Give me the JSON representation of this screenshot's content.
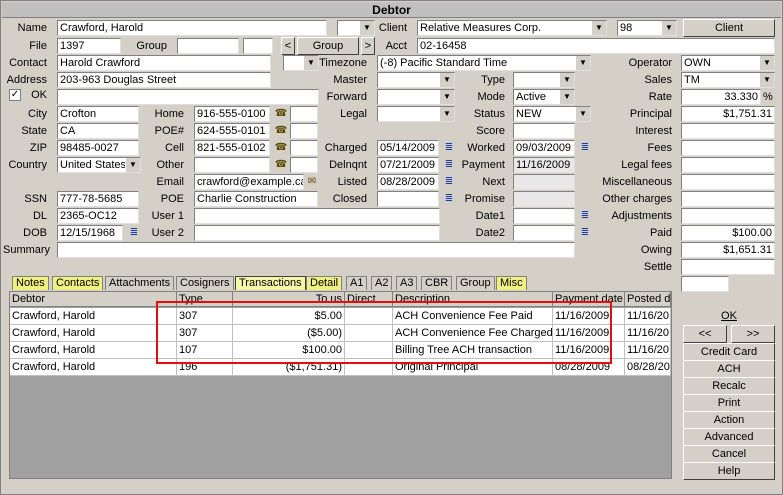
{
  "title": "Debtor",
  "labels": {
    "name": "Name",
    "file": "File",
    "group": "Group",
    "contact": "Contact",
    "address": "Address",
    "ok": "OK",
    "city": "City",
    "state": "State",
    "zip": "ZIP",
    "country": "Country",
    "ssn": "SSN",
    "dl": "DL",
    "dob": "DOB",
    "summary": "Summary",
    "home": "Home",
    "poe_num": "POE#",
    "cell": "Cell",
    "other": "Other",
    "email": "Email",
    "poe": "POE",
    "user1": "User 1",
    "user2": "User 2",
    "client": "Client",
    "acct": "Acct",
    "timezone": "Timezone",
    "master": "Master",
    "forward": "Forward",
    "legal": "Legal",
    "charged": "Charged",
    "delnqnt": "Delnqnt",
    "listed": "Listed",
    "closed": "Closed",
    "type": "Type",
    "mode": "Mode",
    "status": "Status",
    "score": "Score",
    "worked": "Worked",
    "payment": "Payment",
    "next": "Next",
    "promise": "Promise",
    "date1": "Date1",
    "date2": "Date2",
    "operator": "Operator",
    "sales": "Sales",
    "rate": "Rate",
    "principal": "Principal",
    "interest": "Interest",
    "fees": "Fees",
    "legal_fees": "Legal fees",
    "miscellaneous": "Miscellaneous",
    "other_charges": "Other charges",
    "adjustments": "Adjustments",
    "paid": "Paid",
    "owing": "Owing",
    "settle": "Settle"
  },
  "values": {
    "name": "Crawford, Harold",
    "file": "1397",
    "contact": "Harold Crawford",
    "address": "203-963 Douglas Street",
    "city": "Crofton",
    "state": "CA",
    "zip": "98485-0027",
    "country": "United States",
    "ssn": "777-78-5685",
    "dl": "2365-OC12",
    "dob": "12/15/1968",
    "home": "916-555-0100",
    "poe_num": "624-555-0101",
    "cell": "821-555-0102",
    "email": "crawford@example.ca",
    "poe": "Charlie Construction",
    "client": "Relative Measures Corp.",
    "client_num": "98",
    "acct": "02-16458",
    "timezone": "(-8) Pacific Standard Time",
    "charged": "05/14/2009",
    "delnqnt": "07/21/2009",
    "listed": "08/28/2009",
    "mode": "Active",
    "status": "NEW",
    "worked": "09/03/2009",
    "payment": "11/16/2009",
    "operator": "OWN",
    "sales": "TM",
    "rate": "33.330",
    "rate_unit": "%",
    "principal": "$1,751.31",
    "paid": "$100.00",
    "owing": "$1,651.31"
  },
  "buttons": {
    "client": "Client",
    "group": "Group",
    "prev": "<",
    "next": ">",
    "ok": "OK",
    "first": "<<",
    "last": ">>",
    "credit_card": "Credit Card",
    "ach": "ACH",
    "recalc": "Recalc",
    "print": "Print",
    "action": "Action",
    "advanced": "Advanced",
    "cancel": "Cancel",
    "help": "Help"
  },
  "tabs": [
    "Notes",
    "Contacts",
    "Attachments",
    "Cosigners",
    "Transactions",
    "Detail",
    "A1",
    "A2",
    "A3",
    "CBR",
    "Group",
    "Misc"
  ],
  "grid": {
    "columns": [
      "Debtor",
      "Type",
      "To us",
      "Direct",
      "Description",
      "Payment date",
      "Posted da"
    ],
    "rows": [
      [
        "Crawford, Harold",
        "307",
        "$5.00",
        "",
        "ACH Convenience Fee Paid",
        "11/16/2009",
        "11/16/20"
      ],
      [
        "Crawford, Harold",
        "307",
        "($5.00)",
        "",
        "ACH Convenience Fee Charged",
        "11/16/2009",
        "11/16/20"
      ],
      [
        "Crawford, Harold",
        "107",
        "$100.00",
        "",
        "Billing Tree ACH transaction",
        "11/16/2009",
        "11/16/20"
      ],
      [
        "Crawford, Harold",
        "196",
        "($1,751.31)",
        "",
        "Original Principal",
        "08/28/2009",
        "08/28/20"
      ]
    ]
  },
  "icons": {
    "calendar": "≣",
    "phone": "☎",
    "checkmark": "✓",
    "dropdown": "▼"
  },
  "colors": {
    "highlight_box": "#e01010",
    "tab_yellow": "#f0f080",
    "calendar_blue": "#1a3ea8"
  }
}
